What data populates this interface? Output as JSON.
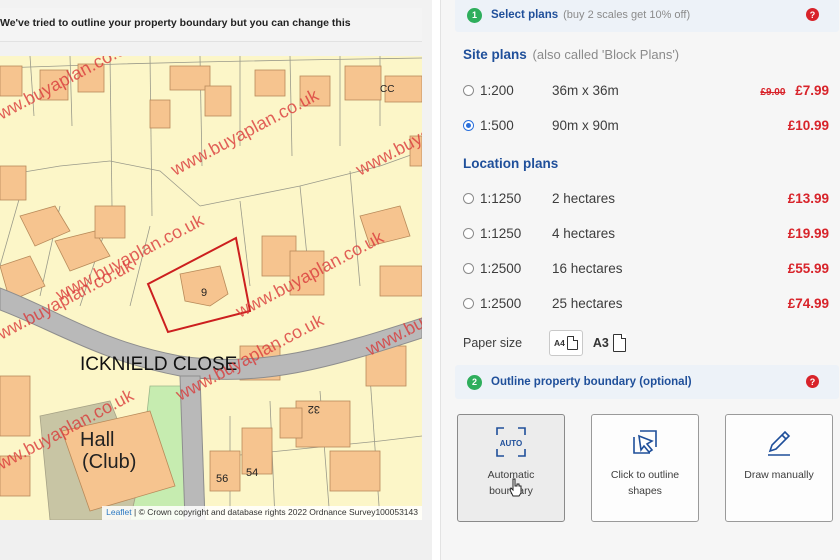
{
  "map": {
    "banner": "We've tried to outline your property boundary but you can change this",
    "street_name": "ICKNIELD CLOSE",
    "labels": {
      "house_9": "9",
      "house_32": "32",
      "house_56": "56",
      "house_54": "54",
      "hall": "Hall",
      "club": "(Club)",
      "house_top": "CC"
    },
    "watermark": "www.buyaplan.co.uk",
    "attribution": {
      "leaflet": "Leaflet",
      "text": "| © Crown copyright and database rights 2022 Ordnance Survey100053143"
    },
    "colors": {
      "land": "#fcf6c8",
      "building": "#f6c48f",
      "road": "#b9b9b9",
      "green": "#c6ecb0",
      "boundary": "#cc1f1f",
      "watermark": "#d93a3a"
    }
  },
  "step1": {
    "number": "1",
    "title": "Select plans",
    "hint": "(buy 2 scales get 10% off)",
    "help": "?"
  },
  "site_plans": {
    "title": "Site plans",
    "hint": "(also called 'Block Plans')",
    "items": [
      {
        "scale": "1:200",
        "size": "36m x 36m",
        "old_price": "£9.00",
        "price": "£7.99",
        "selected": false
      },
      {
        "scale": "1:500",
        "size": "90m x 90m",
        "old_price": "",
        "price": "£10.99",
        "selected": true
      }
    ]
  },
  "location_plans": {
    "title": "Location plans",
    "items": [
      {
        "scale": "1:1250",
        "size": "2 hectares",
        "price": "£13.99",
        "selected": false
      },
      {
        "scale": "1:1250",
        "size": "4 hectares",
        "price": "£19.99",
        "selected": false
      },
      {
        "scale": "1:2500",
        "size": "16 hectares",
        "price": "£55.99",
        "selected": false
      },
      {
        "scale": "1:2500",
        "size": "25 hectares",
        "price": "£74.99",
        "selected": false
      }
    ]
  },
  "paper_size": {
    "label": "Paper size",
    "options": [
      {
        "label": "A4",
        "selected": true
      },
      {
        "label": "A3",
        "selected": false
      }
    ]
  },
  "step2": {
    "number": "2",
    "title": "Outline property boundary (optional)",
    "help": "?"
  },
  "tools": [
    {
      "icon": "auto-boundary-icon",
      "icon_text": "AUTO",
      "label": "Automatic boundary",
      "active": true
    },
    {
      "icon": "click-outline-icon",
      "label": "Click to outline shapes",
      "active": false
    },
    {
      "icon": "pencil-icon",
      "label": "Draw manually",
      "active": false
    }
  ],
  "colors": {
    "accent_blue": "#1f4f9a",
    "price_red": "#d8232a",
    "step_green": "#2eae5c",
    "help_red": "#d8232a"
  }
}
